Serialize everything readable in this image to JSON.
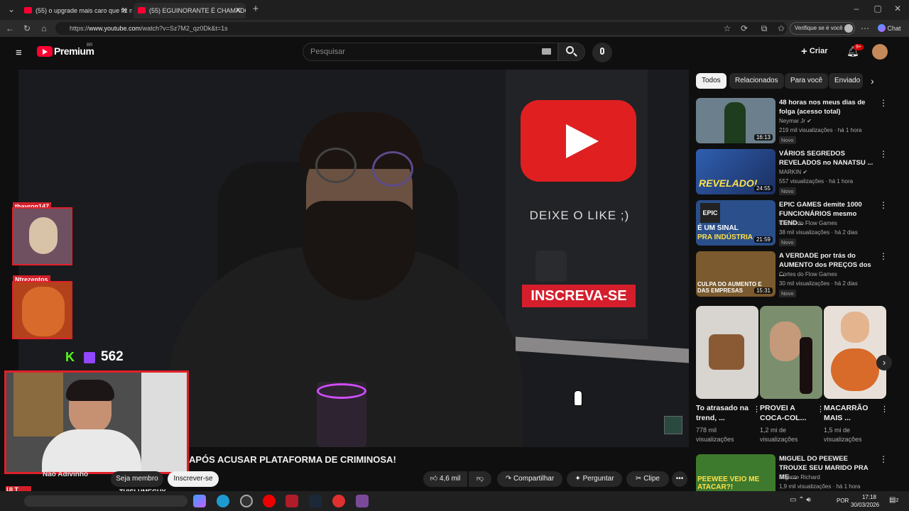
{
  "browser": {
    "tabs": [
      {
        "label": "(55) o upgrade mais caro que fiz n"
      },
      {
        "label": "(55) EGUINORANTE É CHAMADO"
      }
    ],
    "new_tab": "+",
    "url_prefix": "https://",
    "url_host": "www.youtube.com",
    "url_path": "/watch?v=Sz7M2_qz0Dk&t=1s",
    "verify_label": "Verifique se é você",
    "chat_label": "Chat"
  },
  "yt_header": {
    "brand": "Premium",
    "region": "BR",
    "search_placeholder": "Pesquisar",
    "create_label": "Criar",
    "notif_count": "9+"
  },
  "video_overlay": {
    "like_prompt": "DEIXE O LIKE ;)",
    "subscribe_banner": "INSCREVA-SE",
    "reactor_1": "thayron147",
    "reactor_2": "Ntrezentos",
    "viewer_count": "562",
    "kick_letter": "K",
    "streamer_tag": "THISLUMEGUY",
    "ult_sub": "ULT SUB"
  },
  "video_info": {
    "title": "APÓS ACUSAR PLATAFORMA DE CRIMINOSA!",
    "channel": "Não Adivinho",
    "member_label": "Seja membro",
    "subscribe_label": "Inscrever-se",
    "likes": "4,6 mil",
    "share_label": "Compartilhar",
    "ask_label": "Perguntar",
    "clip_label": "Clipe",
    "more": "•••"
  },
  "chips": [
    "Todos",
    "Relacionados",
    "Para você",
    "Enviado"
  ],
  "recommendations": [
    {
      "title": "48 horas nos meus dias de folga (acesso total)",
      "channel": "Neymar Jr",
      "meta": "219 mil visualizações · há 1 hora",
      "badge": "Novo",
      "duration": "16:13",
      "thumb_color": "#6b7f8c"
    },
    {
      "title": "VÁRIOS SEGREDOS REVELADOS no NANATSU ...",
      "channel": "MARKIN",
      "meta": "557 visualizações · há 1 hora",
      "badge": "Novo",
      "duration": "24:55",
      "thumb_color": "#2f5fb0"
    },
    {
      "title": "EPIC GAMES demite 1000 FUNCIONÁRIOS mesmo TEND...",
      "channel": "Cortes do Flow Games",
      "meta": "38 mil visualizações · há 2 dias",
      "badge": "Novo",
      "duration": "21:59",
      "thumb_color": "#2a4f8a"
    },
    {
      "title": "A VERDADE por trás do AUMENTO dos PREÇOS dos ...",
      "channel": "Cortes do Flow Games",
      "meta": "30 mil visualizações · há 2 dias",
      "badge": "Novo",
      "duration": "15:31",
      "thumb_color": "#7a5a2e"
    }
  ],
  "thumb_captions": {
    "r2": "REVELADO!",
    "r3a": "É UM SINAL",
    "r3b": "PRA INDÚSTRIA",
    "r4": "CULPA DO AUMENTO E DAS EMPRESAS"
  },
  "shorts": [
    {
      "title": "To atrasado na trend, ...",
      "views": "778 mil visualizações",
      "thumb_color": "#d8d4cf"
    },
    {
      "title": "PROVEI A COCA-COL...",
      "views": "1,2 mi de visualizações",
      "thumb_color": "#7b8f6f"
    },
    {
      "title": "MACARRÃO MAIS ...",
      "views": "1,5 mi de visualizações",
      "thumb_color": "#d8a07a"
    }
  ],
  "bottom_rec": {
    "title": "MIGUEL DO PEEWEE TROUXE SEU MARIDO PRA ME ...",
    "channel": "Gigante Richard",
    "meta": "1,9 mil visualizações · há 1 hora",
    "caption": "PEEWEE VEIO ME ATACAR?!"
  },
  "taskbar": {
    "lang": "POR",
    "time": "17:18",
    "date": "30/03/2026",
    "notif": "2"
  },
  "colors": {
    "accent": "#ff0033",
    "overlay_red": "#e0202a",
    "kick_green": "#53fc18",
    "twitch_purple": "#9146ff"
  }
}
